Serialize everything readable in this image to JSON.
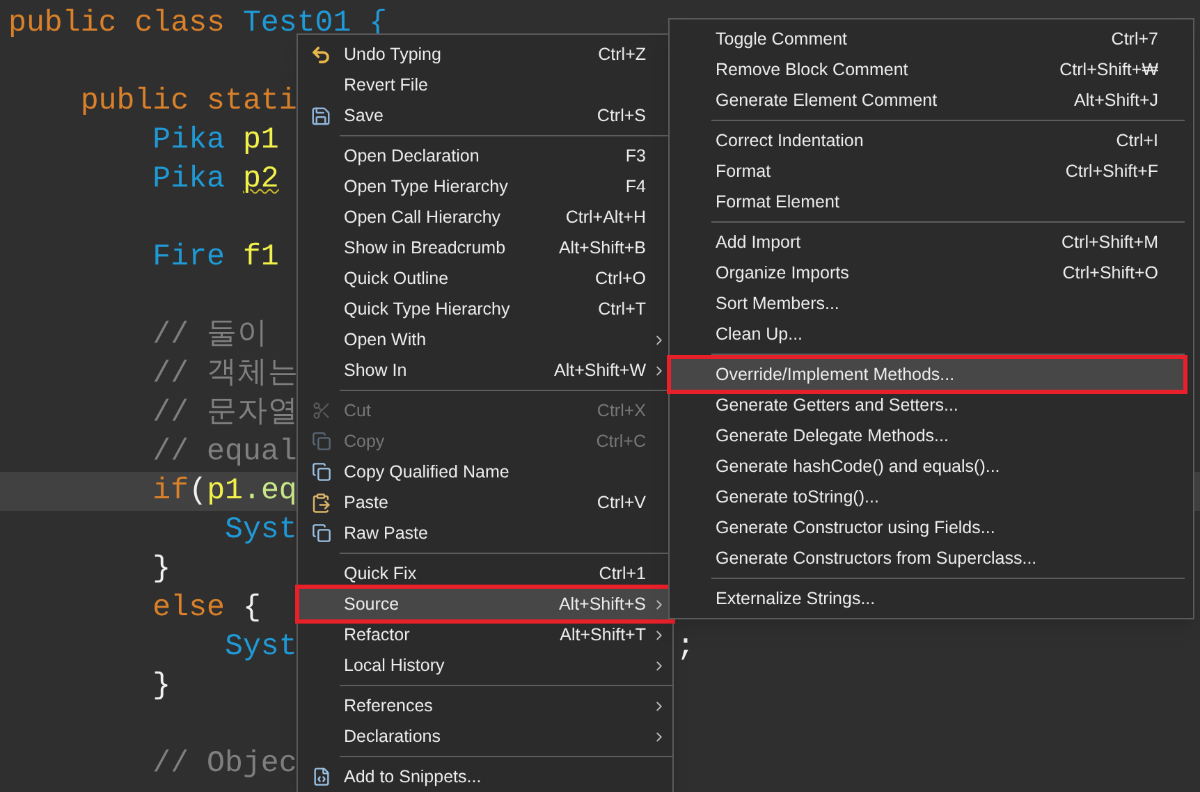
{
  "editor": {
    "blocks": [
      {
        "lines": [
          {
            "segments": [
              {
                "text": "public class ",
                "kind": "keyword"
              },
              {
                "text": "Test01 {",
                "kind": "type"
              }
            ]
          }
        ]
      },
      {
        "lines": [
          {
            "segments": [
              {
                "text": "    public stati",
                "kind": "keyword"
              }
            ]
          },
          {
            "segments": [
              {
                "text": "        Pika ",
                "kind": "type"
              },
              {
                "text": "p1",
                "kind": "variable"
              }
            ]
          },
          {
            "segments": [
              {
                "text": "        Pika ",
                "kind": "type"
              },
              {
                "text": "p2",
                "kind": "variable",
                "warning": true
              }
            ]
          }
        ]
      },
      {
        "lines": [
          {
            "segments": [
              {
                "text": "        Fire ",
                "kind": "type"
              },
              {
                "text": "f1",
                "kind": "variable"
              }
            ]
          }
        ]
      },
      {
        "lines": [
          {
            "segments": [
              {
                "text": "        // 둘이",
                "kind": "comment"
              }
            ]
          },
          {
            "segments": [
              {
                "text": "        // 객체는",
                "kind": "comment"
              }
            ]
          },
          {
            "segments": [
              {
                "text": "        // 문자열",
                "kind": "comment"
              }
            ]
          },
          {
            "segments": [
              {
                "text": "        // equal",
                "kind": "comment"
              }
            ]
          },
          {
            "current": true,
            "segments": [
              {
                "text": "        if",
                "kind": "keyword"
              },
              {
                "text": "(",
                "kind": "plain"
              },
              {
                "text": "p1",
                "kind": "variable"
              },
              {
                "text": ".eq",
                "kind": "method"
              }
            ]
          },
          {
            "segments": [
              {
                "text": "            Syst",
                "kind": "type"
              }
            ]
          },
          {
            "segments": [
              {
                "text": "        }",
                "kind": "plain"
              }
            ]
          },
          {
            "segments": [
              {
                "text": "        else ",
                "kind": "keyword"
              },
              {
                "text": "{",
                "kind": "plain"
              }
            ]
          },
          {
            "segments": [
              {
                "text": "            Syst",
                "kind": "type"
              },
              {
                "text": ";",
                "kind": "plain",
                "after_menu": true
              }
            ]
          },
          {
            "segments": [
              {
                "text": "        }",
                "kind": "plain"
              }
            ]
          }
        ]
      },
      {
        "lines": [
          {
            "segments": [
              {
                "text": "        // Objec",
                "kind": "comment"
              }
            ]
          }
        ]
      }
    ]
  },
  "context_menu": {
    "items": [
      {
        "kind": "item",
        "label": "Undo Typing",
        "shortcut": "Ctrl+Z",
        "disabled": false,
        "highlighted": false,
        "submenu": false
      },
      {
        "kind": "item",
        "label": "Revert File",
        "disabled": false,
        "highlighted": false,
        "submenu": false
      },
      {
        "kind": "item",
        "label": "Save",
        "shortcut": "Ctrl+S",
        "disabled": false,
        "highlighted": false,
        "submenu": false
      },
      {
        "kind": "separator"
      },
      {
        "kind": "item",
        "label": "Open Declaration",
        "shortcut": "F3",
        "disabled": false,
        "highlighted": false,
        "submenu": false
      },
      {
        "kind": "item",
        "label": "Open Type Hierarchy",
        "shortcut": "F4",
        "disabled": false,
        "highlighted": false,
        "submenu": false
      },
      {
        "kind": "item",
        "label": "Open Call Hierarchy",
        "shortcut": "Ctrl+Alt+H",
        "disabled": false,
        "highlighted": false,
        "submenu": false
      },
      {
        "kind": "item",
        "label": "Show in Breadcrumb",
        "shortcut": "Alt+Shift+B",
        "disabled": false,
        "highlighted": false,
        "submenu": false
      },
      {
        "kind": "item",
        "label": "Quick Outline",
        "shortcut": "Ctrl+O",
        "disabled": false,
        "highlighted": false,
        "submenu": false
      },
      {
        "kind": "item",
        "label": "Quick Type Hierarchy",
        "shortcut": "Ctrl+T",
        "disabled": false,
        "highlighted": false,
        "submenu": false
      },
      {
        "kind": "item",
        "label": "Open With",
        "disabled": false,
        "highlighted": false,
        "submenu": true
      },
      {
        "kind": "item",
        "label": "Show In",
        "shortcut": "Alt+Shift+W",
        "disabled": false,
        "highlighted": false,
        "submenu": true
      },
      {
        "kind": "separator"
      },
      {
        "kind": "item",
        "label": "Cut",
        "shortcut": "Ctrl+X",
        "disabled": true,
        "highlighted": false,
        "submenu": false
      },
      {
        "kind": "item",
        "label": "Copy",
        "shortcut": "Ctrl+C",
        "disabled": true,
        "highlighted": false,
        "submenu": false
      },
      {
        "kind": "item",
        "label": "Copy Qualified Name",
        "disabled": false,
        "highlighted": false,
        "submenu": false
      },
      {
        "kind": "item",
        "label": "Paste",
        "shortcut": "Ctrl+V",
        "disabled": false,
        "highlighted": false,
        "submenu": false
      },
      {
        "kind": "item",
        "label": "Raw Paste",
        "disabled": false,
        "highlighted": false,
        "submenu": false
      },
      {
        "kind": "separator"
      },
      {
        "kind": "item",
        "label": "Quick Fix",
        "shortcut": "Ctrl+1",
        "disabled": false,
        "highlighted": false,
        "submenu": false
      },
      {
        "kind": "item",
        "label": "Source",
        "shortcut": "Alt+Shift+S",
        "disabled": false,
        "highlighted": true,
        "annotated": true,
        "submenu": true
      },
      {
        "kind": "item",
        "label": "Refactor",
        "shortcut": "Alt+Shift+T",
        "disabled": false,
        "highlighted": false,
        "submenu": true
      },
      {
        "kind": "item",
        "label": "Local History",
        "disabled": false,
        "highlighted": false,
        "submenu": true
      },
      {
        "kind": "separator"
      },
      {
        "kind": "item",
        "label": "References",
        "disabled": false,
        "highlighted": false,
        "submenu": true
      },
      {
        "kind": "item",
        "label": "Declarations",
        "disabled": false,
        "highlighted": false,
        "submenu": true
      },
      {
        "kind": "separator"
      },
      {
        "kind": "item",
        "label": "Add to Snippets...",
        "disabled": false,
        "highlighted": false,
        "submenu": false
      }
    ]
  },
  "source_submenu": {
    "items": [
      {
        "kind": "item",
        "label": "Toggle Comment",
        "shortcut": "Ctrl+7",
        "highlighted": false
      },
      {
        "kind": "item",
        "label": "Remove Block Comment",
        "shortcut": "Ctrl+Shift+₩",
        "highlighted": false
      },
      {
        "kind": "item",
        "label": "Generate Element Comment",
        "shortcut": "Alt+Shift+J",
        "highlighted": false
      },
      {
        "kind": "separator"
      },
      {
        "kind": "item",
        "label": "Correct Indentation",
        "shortcut": "Ctrl+I",
        "highlighted": false
      },
      {
        "kind": "item",
        "label": "Format",
        "shortcut": "Ctrl+Shift+F",
        "highlighted": false
      },
      {
        "kind": "item",
        "label": "Format Element",
        "highlighted": false
      },
      {
        "kind": "separator"
      },
      {
        "kind": "item",
        "label": "Add Import",
        "shortcut": "Ctrl+Shift+M",
        "highlighted": false
      },
      {
        "kind": "item",
        "label": "Organize Imports",
        "shortcut": "Ctrl+Shift+O",
        "highlighted": false
      },
      {
        "kind": "item",
        "label": "Sort Members...",
        "highlighted": false
      },
      {
        "kind": "item",
        "label": "Clean Up...",
        "highlighted": false
      },
      {
        "kind": "separator"
      },
      {
        "kind": "item",
        "label": "Override/Implement Methods...",
        "highlighted": true,
        "annotated": true
      },
      {
        "kind": "item",
        "label": "Generate Getters and Setters...",
        "highlighted": false
      },
      {
        "kind": "item",
        "label": "Generate Delegate Methods...",
        "highlighted": false
      },
      {
        "kind": "item",
        "label": "Generate hashCode() and equals()...",
        "highlighted": false
      },
      {
        "kind": "item",
        "label": "Generate toString()...",
        "highlighted": false
      },
      {
        "kind": "item",
        "label": "Generate Constructor using Fields...",
        "highlighted": false
      },
      {
        "kind": "item",
        "label": "Generate Constructors from Superclass...",
        "highlighted": false
      },
      {
        "kind": "separator"
      },
      {
        "kind": "item",
        "label": "Externalize Strings...",
        "highlighted": false
      }
    ]
  }
}
